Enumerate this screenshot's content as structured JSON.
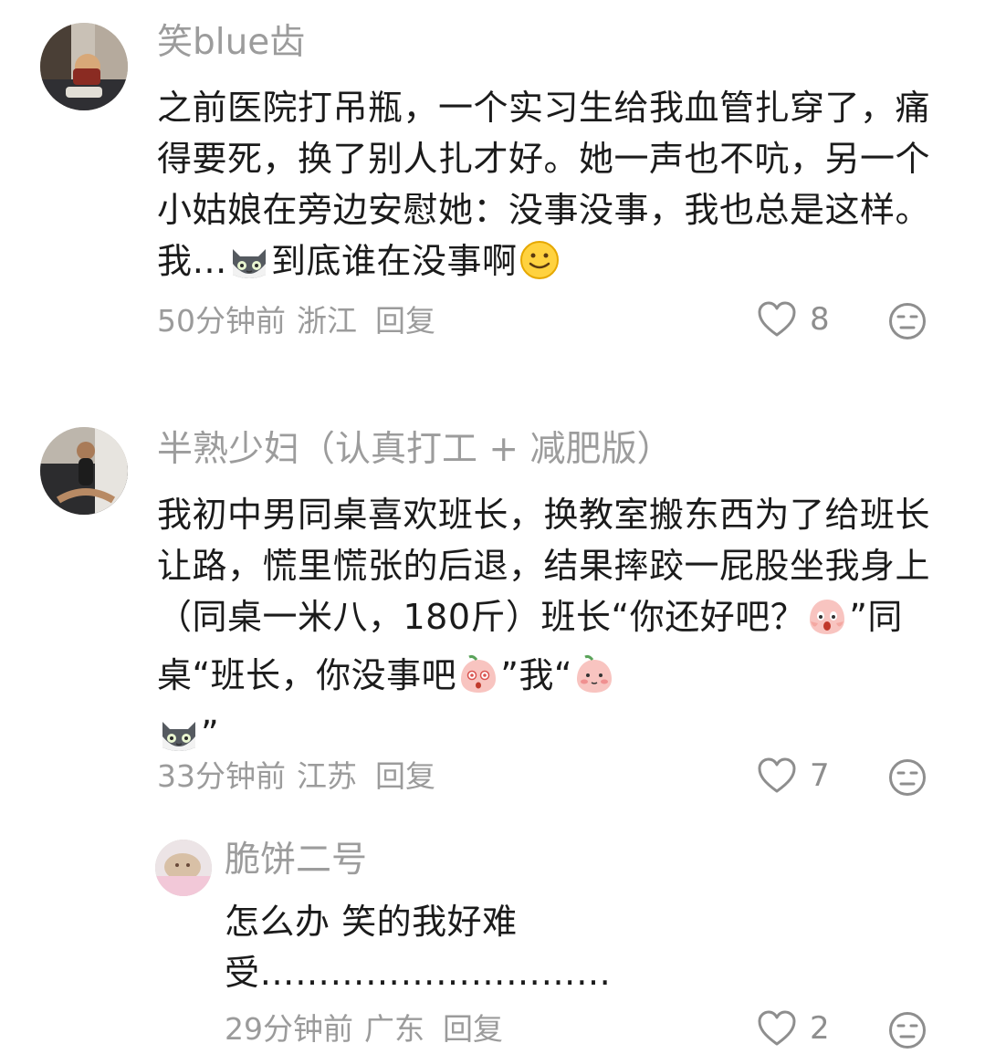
{
  "comments": [
    {
      "username": "笑blue齿",
      "text_parts": [
        "之前医院打吊瓶，一个实习生给我血管扎穿了，痛得要死，换了别人扎才好。她一声也不吭，另一个小姑娘在旁边安慰她：没事没事，我也总是这样。我…",
        "到底谁在没事啊"
      ],
      "time": "50分钟前",
      "location": "浙江",
      "reply_label": "回复",
      "likes": "8"
    },
    {
      "username": "半熟少妇（认真打工 + 减肥版）",
      "text_parts": [
        "我初中男同桌喜欢班长，换教室搬东西为了给班长让路，慌里慌张的后退，结果摔跤一屁股坐我身上（同桌一米八，180斤）班长“你还好吧？",
        "”同桌“班长，你没事吧",
        "”我“",
        "”"
      ],
      "time": "33分钟前",
      "location": "江苏",
      "reply_label": "回复",
      "likes": "7"
    },
    {
      "username": "脆饼二号",
      "text_parts": [
        "怎么办 笑的我好难受…………………………"
      ],
      "time": "29分钟前",
      "location": "广东",
      "reply_label": "回复",
      "likes": "2"
    }
  ],
  "icons": {
    "like": "heart-outline-icon",
    "dislike": "meh-face-icon",
    "emoji_cat": "gray-cat-emoji",
    "emoji_smile": "smile-emoji",
    "emoji_scream": "peach-scream-emoji",
    "emoji_shocked": "peach-shocked-emoji",
    "emoji_blush": "peach-blush-emoji"
  },
  "colors": {
    "username": "#9c9c9c",
    "text": "#1b1b1b",
    "meta": "#9b9b9b"
  }
}
